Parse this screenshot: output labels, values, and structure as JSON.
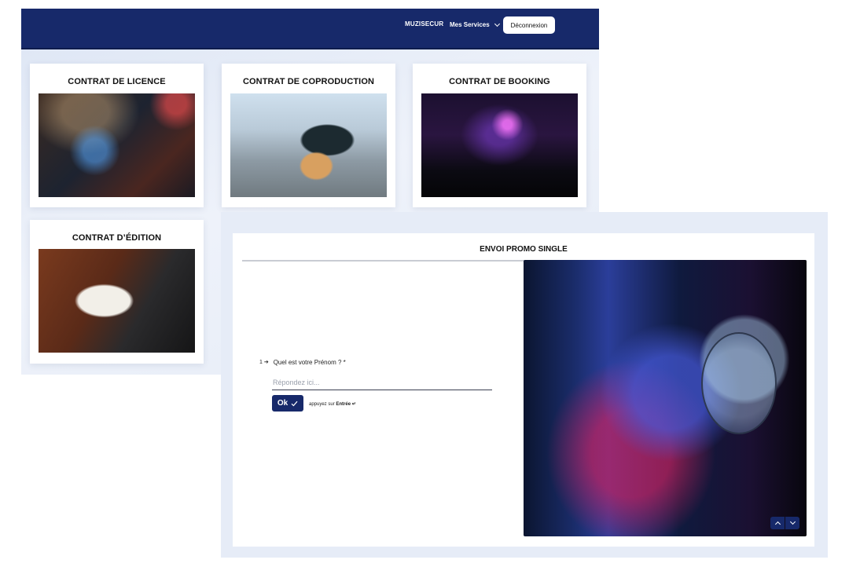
{
  "header": {
    "logo_text": "MUZISECUR",
    "services_label": "Mes Services",
    "logout_label": "Déconnexion"
  },
  "cards": [
    {
      "title": "CONTRAT DE LICENCE",
      "photo": "home-studio-photo"
    },
    {
      "title": "CONTRAT DE COPRODUCTION",
      "photo": "guitarist-photo"
    },
    {
      "title": "CONTRAT DE BOOKING",
      "photo": "concert-crowd-photo"
    },
    {
      "title": "CONTRAT D’ÉDITION",
      "photo": "piano-sheet-music-photo"
    }
  ],
  "form": {
    "title": "ENVOI PROMO SINGLE",
    "question_number": "1 ➔",
    "question": "Quel est votre Prénom ? *",
    "answer_placeholder": "Répondez ici...",
    "ok_label": "Ok",
    "hint_prefix": "appuyez sur",
    "hint_key": "Entrée ↵"
  },
  "colors": {
    "brand_navy": "#17296a",
    "page_background": "#e9eef8"
  }
}
